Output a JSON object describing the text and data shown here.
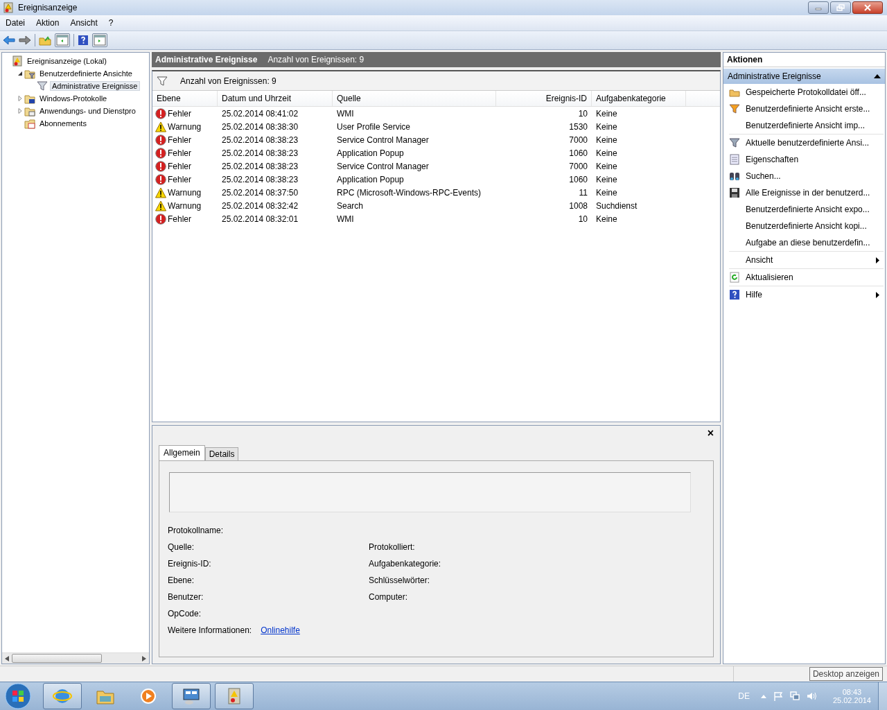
{
  "window": {
    "title": "Ereignisanzeige"
  },
  "menu": [
    "Datei",
    "Aktion",
    "Ansicht",
    "?"
  ],
  "tree": [
    {
      "label": "Ereignisanzeige (Lokal)",
      "kind": "viewer",
      "selected": false,
      "children": [
        {
          "label": "Benutzerdefinierte Ansichte",
          "kind": "folder-filter",
          "expanded": true,
          "selected": false,
          "children": [
            {
              "label": "Administrative Ereignisse",
              "kind": "filter",
              "selected": true
            }
          ]
        },
        {
          "label": "Windows-Protokolle",
          "kind": "folder-log",
          "expanded": false,
          "selected": false
        },
        {
          "label": "Anwendungs- und Dienstpro",
          "kind": "folder-app",
          "expanded": false,
          "selected": false
        },
        {
          "label": "Abonnements",
          "kind": "subscriptions",
          "selected": false
        }
      ]
    }
  ],
  "center": {
    "title": "Administrative Ereignisse",
    "subtitle": "Anzahl von Ereignissen: 9",
    "filter_text": "Anzahl von Ereignissen: 9"
  },
  "table": {
    "columns": [
      "Ebene",
      "Datum und Uhrzeit",
      "Quelle",
      "Ereignis-ID",
      "Aufgabenkategorie"
    ],
    "rows": [
      {
        "kind": "error",
        "level": "Fehler",
        "date": "25.02.2014 08:41:02",
        "source": "WMI",
        "id": "10",
        "category": "Keine"
      },
      {
        "kind": "warning",
        "level": "Warnung",
        "date": "25.02.2014 08:38:30",
        "source": "User Profile Service",
        "id": "1530",
        "category": "Keine"
      },
      {
        "kind": "error",
        "level": "Fehler",
        "date": "25.02.2014 08:38:23",
        "source": "Service Control Manager",
        "id": "7000",
        "category": "Keine"
      },
      {
        "kind": "error",
        "level": "Fehler",
        "date": "25.02.2014 08:38:23",
        "source": "Application Popup",
        "id": "1060",
        "category": "Keine"
      },
      {
        "kind": "error",
        "level": "Fehler",
        "date": "25.02.2014 08:38:23",
        "source": "Service Control Manager",
        "id": "7000",
        "category": "Keine"
      },
      {
        "kind": "error",
        "level": "Fehler",
        "date": "25.02.2014 08:38:23",
        "source": "Application Popup",
        "id": "1060",
        "category": "Keine"
      },
      {
        "kind": "warning",
        "level": "Warnung",
        "date": "25.02.2014 08:37:50",
        "source": "RPC (Microsoft-Windows-RPC-Events)",
        "id": "11",
        "category": "Keine"
      },
      {
        "kind": "warning",
        "level": "Warnung",
        "date": "25.02.2014 08:32:42",
        "source": "Search",
        "id": "1008",
        "category": "Suchdienst"
      },
      {
        "kind": "error",
        "level": "Fehler",
        "date": "25.02.2014 08:32:01",
        "source": "WMI",
        "id": "10",
        "category": "Keine"
      }
    ]
  },
  "details": {
    "close": "×",
    "tabs": [
      {
        "label": "Allgemein",
        "selected": true
      },
      {
        "label": "Details",
        "selected": false
      }
    ],
    "rows": [
      [
        {
          "label": "Protokollname:"
        }
      ],
      [
        {
          "label": "Quelle:"
        },
        {
          "label": "Protokolliert:"
        }
      ],
      [
        {
          "label": "Ereignis-ID:"
        },
        {
          "label": "Aufgabenkategorie:"
        }
      ],
      [
        {
          "label": "Ebene:"
        },
        {
          "label": "Schlüsselwörter:"
        }
      ],
      [
        {
          "label": "Benutzer:"
        },
        {
          "label": "Computer:"
        }
      ],
      [
        {
          "label": "OpCode:"
        }
      ],
      [
        {
          "label": "Weitere Informationen:",
          "link": "Onlinehilfe"
        }
      ]
    ]
  },
  "actions": {
    "title": "Aktionen",
    "section": "Administrative Ereignisse",
    "groups": [
      [
        {
          "label": "Gespeicherte Protokolldatei öff...",
          "kind": "folder"
        },
        {
          "label": "Benutzerdefinierte Ansicht erste...",
          "kind": "filter-new"
        },
        {
          "label": "Benutzerdefinierte Ansicht imp..."
        }
      ],
      [
        {
          "label": "Aktuelle benutzerdefinierte Ansi...",
          "kind": "filter"
        },
        {
          "label": "Eigenschaften",
          "kind": "properties"
        },
        {
          "label": "Suchen...",
          "kind": "binoculars"
        },
        {
          "label": "Alle Ereignisse in der benutzerd...",
          "kind": "save"
        },
        {
          "label": "Benutzerdefinierte Ansicht expo..."
        },
        {
          "label": "Benutzerdefinierte Ansicht kopi..."
        },
        {
          "label": "Aufgabe an diese benutzerdefin..."
        }
      ],
      [
        {
          "label": "Ansicht",
          "submenu": true
        }
      ],
      [
        {
          "label": "Aktualisieren",
          "kind": "refresh"
        }
      ],
      [
        {
          "label": "Hilfe",
          "kind": "help",
          "submenu": true
        }
      ]
    ]
  },
  "taskbar": {
    "apps": [
      {
        "kind": "browser",
        "running": true
      },
      {
        "kind": "explorer",
        "running": false
      },
      {
        "kind": "media",
        "running": false
      },
      {
        "kind": "control-panel",
        "running": true
      },
      {
        "kind": "event-viewer",
        "running": true
      }
    ],
    "language": "DE",
    "time": "08:43",
    "date": "25.02.2014",
    "tooltip": "Desktop anzeigen"
  }
}
